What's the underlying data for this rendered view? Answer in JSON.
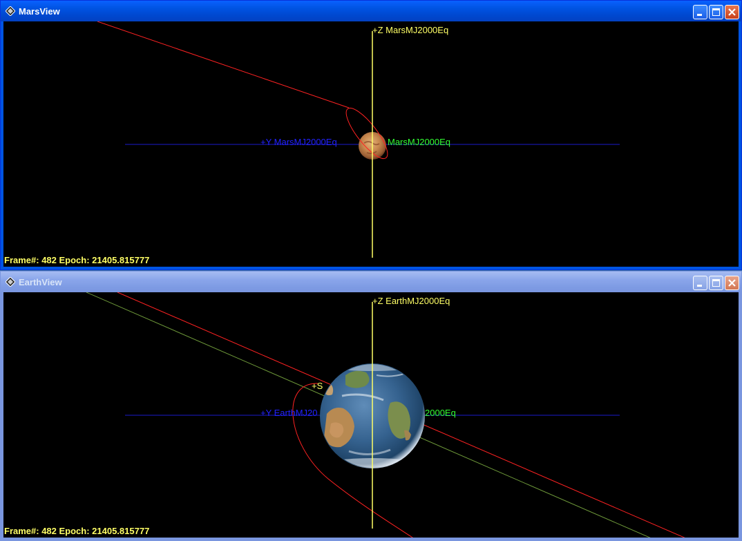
{
  "mars_window": {
    "title": "MarsView",
    "z_axis_label": "+Z MarsMJ2000Eq",
    "y_axis_label": "+Y MarsMJ2000Eq",
    "x_axis_label": "MarsMJ2000Eq",
    "status": "Frame#: 482  Epoch: 21405.815777"
  },
  "earth_window": {
    "title": "EarthView",
    "z_axis_label": "+Z EarthMJ2000Eq",
    "y_axis_label": "+Y EarthMJ20",
    "x_axis_label": "2000Eq",
    "s_label": "+S",
    "status": "Frame#: 482  Epoch: 21405.815777"
  },
  "colors": {
    "z_axis": "#ffff66",
    "y_axis": "#2222ff",
    "x_axis": "#33ff33",
    "orbit": "#ff2222",
    "trajectory": "#6f9a3a"
  },
  "icons": {
    "window_icon": "app-diamond-icon",
    "minimize": "minimize-icon",
    "maximize": "maximize-icon",
    "close": "close-icon"
  }
}
